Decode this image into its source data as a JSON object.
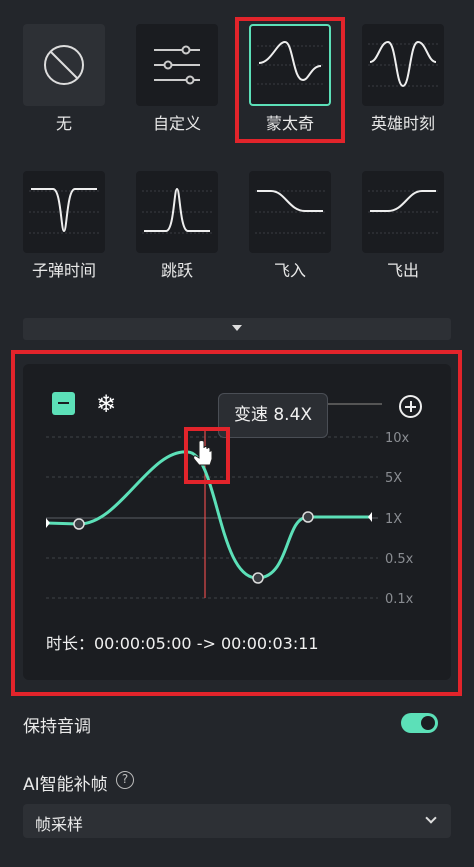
{
  "presets": [
    {
      "label": "无",
      "icon": "none-icon"
    },
    {
      "label": "自定义",
      "icon": "sliders-icon"
    },
    {
      "label": "蒙太奇",
      "icon": "montage-curve-icon",
      "selected": true
    },
    {
      "label": "英雄时刻",
      "icon": "hero-moment-curve-icon"
    },
    {
      "label": "子弹时间",
      "icon": "bullet-time-curve-icon"
    },
    {
      "label": "跳跃",
      "icon": "jump-curve-icon"
    },
    {
      "label": "飞入",
      "icon": "fly-in-curve-icon"
    },
    {
      "label": "飞出",
      "icon": "fly-out-curve-icon"
    }
  ],
  "curve_editor": {
    "tooltip": "变速 8.4X",
    "speed_labels": [
      "10x",
      "5X",
      "1X",
      "0.5x",
      "0.1x"
    ],
    "duration": "时长：00:00:05:00 -> 00:00:03:11",
    "icons": {
      "remove": "minus-icon",
      "freeze": "snowflake-icon",
      "add": "plus-circle-icon",
      "cursor": "hand-cursor-icon"
    }
  },
  "settings": {
    "keep_pitch_label": "保持音调",
    "keep_pitch_on": true,
    "ai_frame_label": "AI智能补帧",
    "ai_frame_value": "帧采样"
  },
  "colors": {
    "accent": "#5ce0b8",
    "highlight": "#e2242b",
    "playhead": "#e24a4a"
  }
}
